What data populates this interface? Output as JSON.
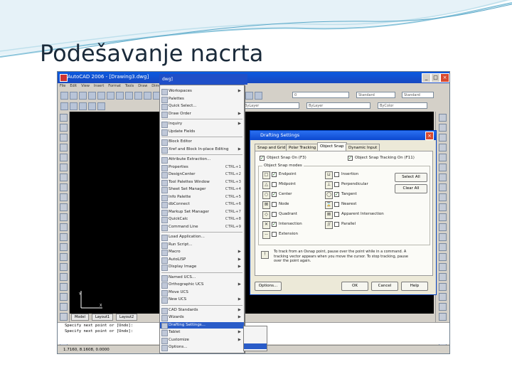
{
  "slide": {
    "title": "Podešavanje nacrta"
  },
  "app": {
    "title": "AutoCAD 2006 - [Drawing3.dwg]",
    "menubar": [
      "File",
      "Edit",
      "View",
      "Insert",
      "Format",
      "Tools",
      "Draw",
      "Dimension",
      "Modify",
      "Window",
      "Help"
    ],
    "layer_combo": "0",
    "style_combo": "Standard",
    "linetype_combos": [
      "ByLayer",
      "ByLayer",
      "ByColor"
    ],
    "layout_tabs": [
      "Model",
      "Layout1",
      "Layout2"
    ],
    "command_lines": [
      "Specify next point or [Undo]:",
      "Specify next point or [Undo]:"
    ],
    "status_text": "1.7160, 8.1608, 0.0000"
  },
  "tools_menu": {
    "header": "dwg]",
    "items": [
      {
        "label": "Workspaces",
        "shortcut": "▶",
        "sep_after": false
      },
      {
        "label": "Palettes",
        "shortcut": "",
        "sep_after": false
      },
      {
        "label": "Quick Select...",
        "shortcut": "",
        "sep_after": false
      },
      {
        "label": "Draw Order",
        "shortcut": "▶",
        "sep_after": true
      },
      {
        "label": "Inquiry",
        "shortcut": "▶",
        "sep_after": false
      },
      {
        "label": "Update Fields",
        "shortcut": "",
        "sep_after": true
      },
      {
        "label": "Block Editor",
        "shortcut": "",
        "sep_after": false
      },
      {
        "label": "Xref and Block In-place Editing",
        "shortcut": "▶",
        "sep_after": true
      },
      {
        "label": "Attribute Extraction...",
        "shortcut": "",
        "sep_after": false
      },
      {
        "label": "Properties",
        "shortcut": "CTRL+1",
        "sep_after": false
      },
      {
        "label": "DesignCenter",
        "shortcut": "CTRL+2",
        "sep_after": false
      },
      {
        "label": "Tool Palettes Window",
        "shortcut": "CTRL+3",
        "sep_after": false
      },
      {
        "label": "Sheet Set Manager",
        "shortcut": "CTRL+4",
        "sep_after": false
      },
      {
        "label": "Info Palette",
        "shortcut": "CTRL+5",
        "sep_after": false
      },
      {
        "label": "dbConnect",
        "shortcut": "CTRL+6",
        "sep_after": false
      },
      {
        "label": "Markup Set Manager",
        "shortcut": "CTRL+7",
        "sep_after": false
      },
      {
        "label": "QuickCalc",
        "shortcut": "CTRL+8",
        "sep_after": false
      },
      {
        "label": "Command Line",
        "shortcut": "CTRL+9",
        "sep_after": true
      },
      {
        "label": "Load Application...",
        "shortcut": "",
        "sep_after": false
      },
      {
        "label": "Run Script...",
        "shortcut": "",
        "sep_after": false
      },
      {
        "label": "Macro",
        "shortcut": "▶",
        "sep_after": false
      },
      {
        "label": "AutoLISP",
        "shortcut": "▶",
        "sep_after": false
      },
      {
        "label": "Display Image",
        "shortcut": "▶",
        "sep_after": true
      },
      {
        "label": "Named UCS...",
        "shortcut": "",
        "sep_after": false
      },
      {
        "label": "Orthographic UCS",
        "shortcut": "▶",
        "sep_after": false
      },
      {
        "label": "Move UCS",
        "shortcut": "",
        "sep_after": false
      },
      {
        "label": "New UCS",
        "shortcut": "▶",
        "sep_after": true
      },
      {
        "label": "CAD Standards",
        "shortcut": "▶",
        "sep_after": false
      },
      {
        "label": "Wizards",
        "shortcut": "▶",
        "sep_after": false
      },
      {
        "label": "Drafting Settings...",
        "shortcut": "",
        "sep_after": false,
        "selected": true
      },
      {
        "label": "Tablet",
        "shortcut": "▶",
        "sep_after": false
      },
      {
        "label": "Customize",
        "shortcut": "▶",
        "sep_after": false
      },
      {
        "label": "Options...",
        "shortcut": "",
        "sep_after": false
      }
    ]
  },
  "dialog": {
    "title": "Drafting Settings",
    "tabs": [
      "Snap and Grid",
      "Polar Tracking",
      "Object Snap",
      "Dynamic Input"
    ],
    "active_tab": 2,
    "osnap_on": "Object Snap On (F3)",
    "tracking_on": "Object Snap Tracking On (F11)",
    "group_label": "Object Snap modes",
    "left_modes": [
      {
        "icon": "□",
        "label": "Endpoint",
        "checked": true
      },
      {
        "icon": "△",
        "label": "Midpoint",
        "checked": false
      },
      {
        "icon": "○",
        "label": "Center",
        "checked": true
      },
      {
        "icon": "⊠",
        "label": "Node",
        "checked": false
      },
      {
        "icon": "◇",
        "label": "Quadrant",
        "checked": false
      },
      {
        "icon": "✕",
        "label": "Intersection",
        "checked": true
      },
      {
        "icon": "--",
        "label": "Extension",
        "checked": false
      }
    ],
    "right_modes": [
      {
        "icon": "⊔",
        "label": "Insertion",
        "checked": false
      },
      {
        "icon": "⊥",
        "label": "Perpendicular",
        "checked": false
      },
      {
        "icon": "◯",
        "label": "Tangent",
        "checked": true
      },
      {
        "icon": "⌛",
        "label": "Nearest",
        "checked": false
      },
      {
        "icon": "⊠",
        "label": "Apparent Intersection",
        "checked": false
      },
      {
        "icon": "//",
        "label": "Parallel",
        "checked": false
      }
    ],
    "select_all": "Select All",
    "clear_all": "Clear All",
    "hint": "To track from an Osnap point, pause over the point while in a command. A tracking vector appears when you move the cursor. To stop tracking, pause over the point again.",
    "buttons": [
      "Options...",
      "OK",
      "Cancel",
      "Help"
    ]
  }
}
